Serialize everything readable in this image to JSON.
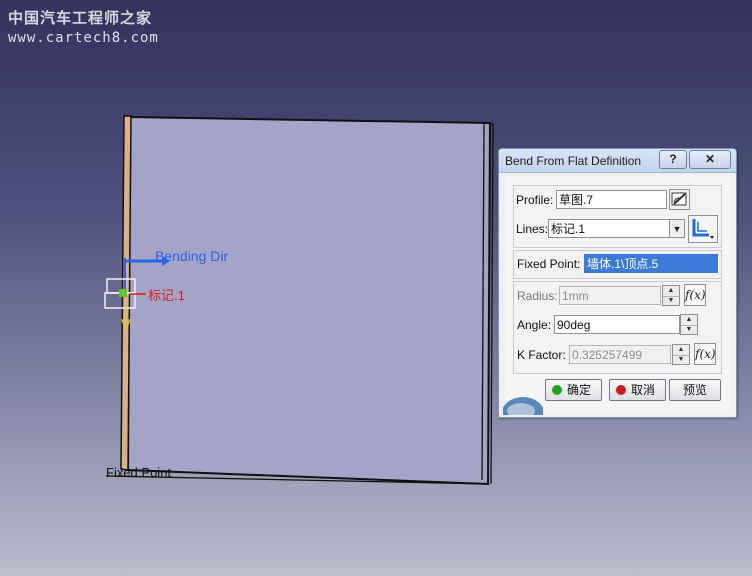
{
  "watermark": {
    "line1": "中国汽车工程师之家",
    "line2": "www.cartech8.com"
  },
  "viewport": {
    "bending_dir_label": "Bending Dir",
    "mark_label": "标记.1",
    "fixed_point_label": "Fixed Point",
    "part_fill_color": "#a3a4c7",
    "arrow_color": "#2b63e0",
    "mark_color": "#e01818"
  },
  "dialog": {
    "title": "Bend From Flat Definition",
    "help_label": "?",
    "close_label": "✕",
    "profile_label": "Profile:",
    "profile_value": "草图.7",
    "lines_label": "Lines:",
    "lines_value": "标记.1",
    "fixed_point_label": "Fixed Point:",
    "fixed_point_value": "墙体.1\\顶点.5",
    "radius_label": "Radius:",
    "radius_value": "1mm",
    "angle_label": "Angle:",
    "angle_value": "90deg",
    "kfactor_label": "K Factor:",
    "kfactor_value": "0.325257499",
    "fx_label": "f(x)",
    "ok_label": "确定",
    "cancel_label": "取消",
    "preview_label": "预览",
    "ok_dot_color": "#1fa31f",
    "cancel_dot_color": "#d21a1a"
  }
}
